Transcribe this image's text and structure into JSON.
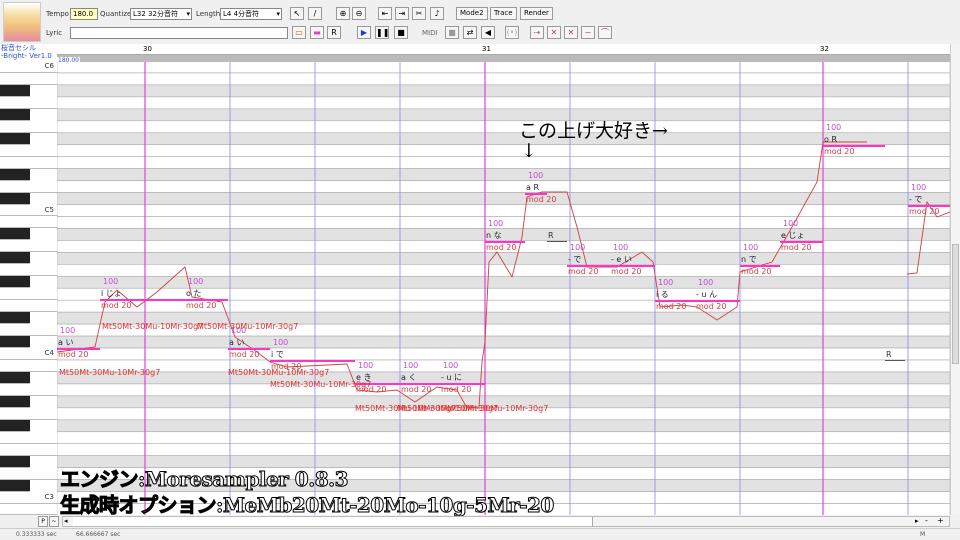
{
  "toolbar": {
    "tempo_label": "Tempo",
    "tempo_value": "180.0",
    "quantize_label": "Quantize",
    "quantize_value": "L32 32分音符",
    "length_label": "Length",
    "length_value": "L4 4分音符",
    "lyric_label": "Lyric",
    "lyric_value": "",
    "mode2": "Mode2",
    "trace": "Trace",
    "render": "Render",
    "midi": "MIDI"
  },
  "voicebank": {
    "name": "桜音セシル",
    "version": "-Bright- Ver1.0"
  },
  "ruler": {
    "measures": [
      "30",
      "31",
      "32"
    ],
    "tempo": "180.00"
  },
  "keys": {
    "labels": [
      "C6",
      "C5",
      "C4",
      "C3"
    ]
  },
  "notes": [
    {
      "lyric": "a い",
      "velocity": "100",
      "mod": "mod 20"
    },
    {
      "lyric": "i じょ",
      "velocity": "100",
      "mod": "mod 20"
    },
    {
      "lyric": "o た",
      "velocity": "100",
      "mod": "mod 20"
    },
    {
      "lyric": "a い",
      "velocity": "100",
      "mod": "mod 20"
    },
    {
      "lyric": "i で",
      "velocity": "100",
      "mod": "mod 20"
    },
    {
      "lyric": "e き",
      "velocity": "100",
      "mod": "mod 20"
    },
    {
      "lyric": "a く",
      "velocity": "100",
      "mod": "mod 20"
    },
    {
      "lyric": "- u に",
      "velocity": "100",
      "mod": "mod 20"
    },
    {
      "lyric": "n な",
      "velocity": "100",
      "mod": "mod 20"
    },
    {
      "lyric": "a R",
      "velocity": "100",
      "mod": "mod 20"
    },
    {
      "lyric": "R",
      "velocity": "",
      "mod": ""
    },
    {
      "lyric": "- で",
      "velocity": "100",
      "mod": "mod 20"
    },
    {
      "lyric": "- e い",
      "velocity": "100",
      "mod": "mod 20"
    },
    {
      "lyric": "i る",
      "velocity": "100",
      "mod": "mod 20"
    },
    {
      "lyric": "- u ん",
      "velocity": "100",
      "mod": "mod 20"
    },
    {
      "lyric": "n で",
      "velocity": "100",
      "mod": "mod 20"
    },
    {
      "lyric": "e じょ",
      "velocity": "100",
      "mod": "mod 20"
    },
    {
      "lyric": "o R",
      "velocity": "100",
      "mod": "mod 20"
    },
    {
      "lyric": "R",
      "velocity": "",
      "mod": ""
    },
    {
      "lyric": "- で",
      "velocity": "100",
      "mod": "mod 20"
    }
  ],
  "flags": [
    "Mt50Mt-30Mu-10Mr-30g7"
  ],
  "annotation": {
    "text": "この上げ大好き→",
    "arrow": "↓"
  },
  "overlay": {
    "engine": "エンジン:Moresampler 0.8.3",
    "options": "生成時オプション:MeMb20Mt-20Mo-10g-5Mr-20"
  },
  "status": {
    "pos1": "0.333333 sec",
    "pos2": "66.666667 sec",
    "mode": "M"
  },
  "colors": {
    "note": "#ff33cc",
    "pitch": "#d04040",
    "flag": "#e03030",
    "beat_line": "#8888ee",
    "measure_line": "#dd44dd"
  }
}
